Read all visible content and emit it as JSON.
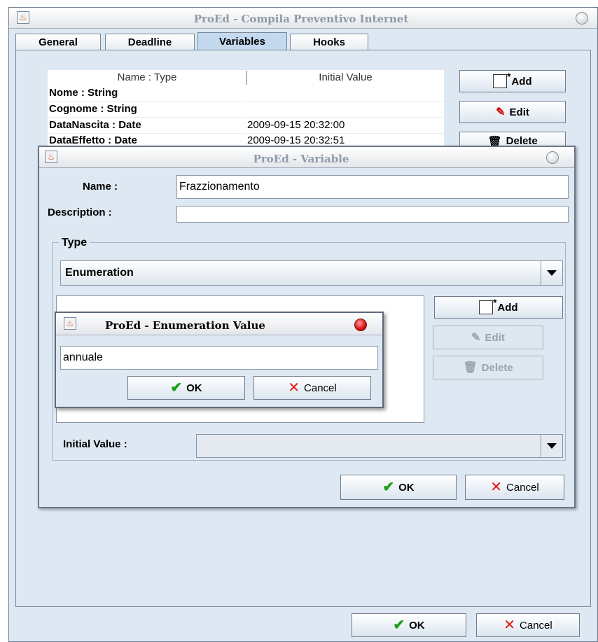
{
  "main_window": {
    "title": "ProEd - Compila Preventivo Internet",
    "tabs": [
      {
        "label": "General",
        "active": false
      },
      {
        "label": "Deadline",
        "active": false
      },
      {
        "label": "Variables",
        "active": true
      },
      {
        "label": "Hooks",
        "active": false
      }
    ],
    "table": {
      "headers": [
        "Name : Type",
        "Initial Value"
      ],
      "rows": [
        {
          "name": "Nome : String",
          "value": ""
        },
        {
          "name": "Cognome : String",
          "value": ""
        },
        {
          "name": "DataNascita : Date",
          "value": "2009-09-15 20:32:00"
        },
        {
          "name": "DataEffetto : Date",
          "value": "2009-09-15 20:32:51"
        }
      ]
    },
    "buttons": {
      "add": "Add",
      "edit": "Edit",
      "delete": "Delete",
      "ok": "OK",
      "cancel": "Cancel"
    }
  },
  "variable_dialog": {
    "title": "ProEd - Variable",
    "name_label": "Name :",
    "name_value": "Frazzionamento",
    "description_label": "Description :",
    "description_value": "",
    "type_group_label": "Type",
    "type_selected": "Enumeration",
    "buttons": {
      "add": "Add",
      "edit": "Edit",
      "delete": "Delete",
      "ok": "OK",
      "cancel": "Cancel"
    },
    "initial_value_label": "Initial Value :",
    "initial_value": ""
  },
  "enum_dialog": {
    "title": "ProEd - Enumeration Value",
    "value": "annuale",
    "buttons": {
      "ok": "OK",
      "cancel": "Cancel"
    }
  },
  "colors": {
    "accent": "#c4d9ee",
    "panel": "#dde8f3",
    "ok_check": "#1ea01e",
    "cancel_x": "#e01818"
  }
}
